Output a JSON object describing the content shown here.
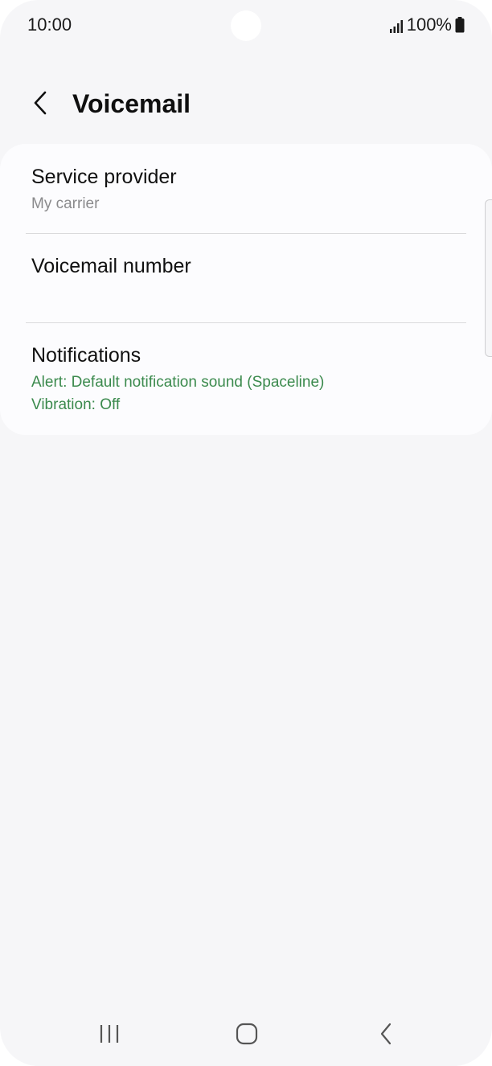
{
  "status_bar": {
    "time": "10:00",
    "battery_text": "100%",
    "icons": [
      "signal-icon",
      "battery-icon"
    ]
  },
  "header": {
    "back_icon": "chevron-left-icon",
    "title": "Voicemail"
  },
  "settings": {
    "service_provider": {
      "title": "Service provider",
      "subtitle": "My carrier"
    },
    "voicemail_number": {
      "title": "Voicemail number"
    },
    "notifications": {
      "title": "Notifications",
      "alert": "Alert: Default notification sound (Spaceline)",
      "vibration": "Vibration: Off"
    }
  },
  "nav_bar": {
    "icons": [
      "recents-icon",
      "home-icon",
      "back-icon"
    ]
  },
  "colors": {
    "background": "#f6f6f8",
    "card": "#fcfcfe",
    "accent_green": "#3b8a4d",
    "subtitle_gray": "#8a8a8c"
  }
}
